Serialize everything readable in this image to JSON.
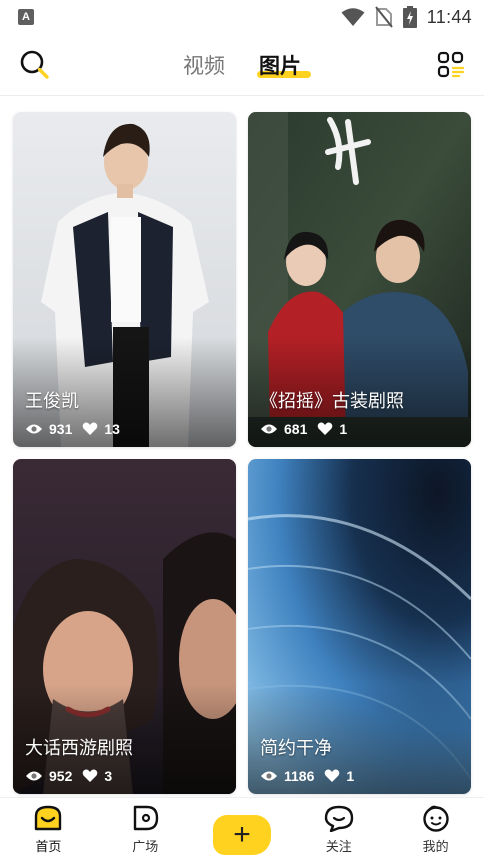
{
  "status_bar": {
    "app_icon_letter": "A",
    "time": "11:44",
    "icons": [
      "wifi-icon",
      "no-sim-icon",
      "battery-charging-icon"
    ]
  },
  "header": {
    "search_icon": "search-icon",
    "grid_icon": "grid-menu-icon",
    "tabs": [
      {
        "label": "视频",
        "active": false
      },
      {
        "label": "图片",
        "active": true
      }
    ],
    "accent_color": "#ffd21f"
  },
  "feed": {
    "cards": [
      {
        "title": "王俊凯",
        "views": "931",
        "likes": "13"
      },
      {
        "title": "《招摇》古装剧照",
        "views": "681",
        "likes": "1"
      },
      {
        "title": "大话西游剧照",
        "views": "952",
        "likes": "3"
      },
      {
        "title": "简约干净",
        "views": "1186",
        "likes": "1"
      }
    ]
  },
  "bottom_nav": {
    "items": [
      {
        "label": "首页",
        "icon": "home-icon",
        "active": true
      },
      {
        "label": "广场",
        "icon": "square-tag-icon",
        "active": false
      },
      {
        "label": "",
        "icon": "plus-icon",
        "plus": "+"
      },
      {
        "label": "关注",
        "icon": "chat-bubble-icon",
        "active": false
      },
      {
        "label": "我的",
        "icon": "face-icon",
        "active": false
      }
    ]
  }
}
